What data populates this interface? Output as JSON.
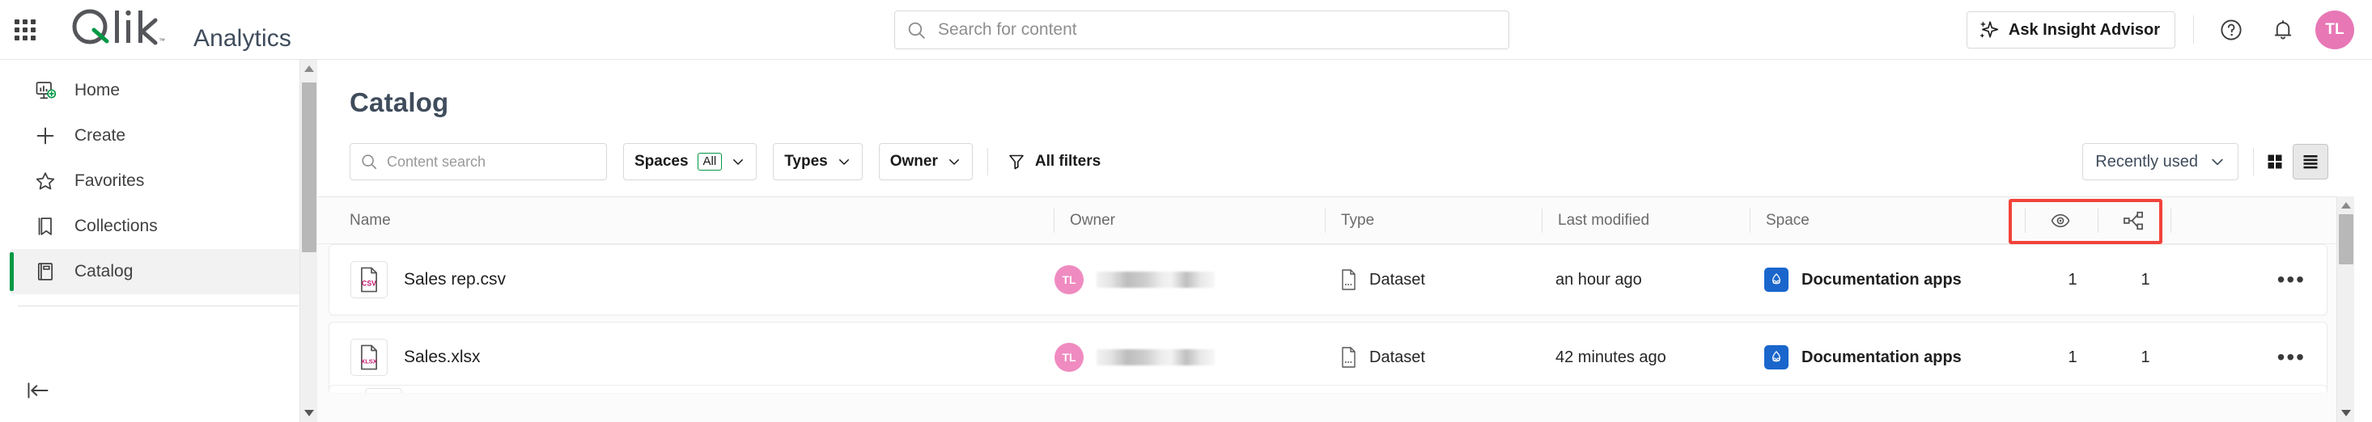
{
  "topbar": {
    "launcher_icon": "grid-apps-icon",
    "logo_text": "Qlik",
    "app_name": "Analytics",
    "search": {
      "placeholder": "Search for content",
      "value": "",
      "icon": "search-icon"
    },
    "insight_advisor_label": "Ask Insight Advisor",
    "insight_icon": "sparkle-icon",
    "help_icon": "help-circle-icon",
    "notifications_icon": "bell-icon",
    "avatar_initials": "TL",
    "avatar_color": "#e877b6"
  },
  "sidebar": {
    "items": [
      {
        "label": "Home",
        "icon": "home-chart-icon",
        "active": false
      },
      {
        "label": "Create",
        "icon": "plus-icon",
        "active": false
      },
      {
        "label": "Favorites",
        "icon": "star-icon",
        "active": false
      },
      {
        "label": "Collections",
        "icon": "bookmark-icon",
        "active": false
      },
      {
        "label": "Catalog",
        "icon": "catalog-book-icon",
        "active": true
      }
    ],
    "collapse_icon": "collapse-left-icon",
    "active_accent": "#009845"
  },
  "main": {
    "page_title": "Catalog",
    "toolbar": {
      "content_search": {
        "placeholder": "Content search",
        "value": "",
        "icon": "search-icon"
      },
      "spaces": {
        "label": "Spaces",
        "badge": "All",
        "chevron": "chevron-down-icon",
        "badge_border": "#009845"
      },
      "types": {
        "label": "Types",
        "chevron": "chevron-down-icon"
      },
      "owner": {
        "label": "Owner",
        "chevron": "chevron-down-icon"
      },
      "all_filters": {
        "label": "All filters",
        "icon": "funnel-icon"
      },
      "sort": {
        "label": "Recently used",
        "chevron": "chevron-down-icon"
      },
      "view_grid": {
        "icon": "grid-view-icon",
        "selected": false
      },
      "view_list": {
        "icon": "list-view-icon",
        "selected": true
      }
    },
    "table": {
      "columns": [
        {
          "key": "name",
          "label": "Name"
        },
        {
          "key": "owner",
          "label": "Owner"
        },
        {
          "key": "type",
          "label": "Type"
        },
        {
          "key": "last_modified",
          "label": "Last modified"
        },
        {
          "key": "space",
          "label": "Space"
        },
        {
          "key": "views",
          "label": "",
          "icon": "eye-icon"
        },
        {
          "key": "lineage",
          "label": "",
          "icon": "lineage-graph-icon"
        }
      ],
      "rows": [
        {
          "name": "Sales rep.csv",
          "file_icon": "csv-file-icon",
          "file_ext": "CSV",
          "owner_initials": "TL",
          "owner_name": "",
          "type": "Dataset",
          "type_icon": "dataset-file-icon",
          "last_modified": "an hour ago",
          "space": "Documentation apps",
          "space_icon": "shared-space-icon",
          "views": "1",
          "lineage": "1",
          "menu_icon": "more-horizontal-icon"
        },
        {
          "name": "Sales.xlsx",
          "file_icon": "xlsx-file-icon",
          "file_ext": "XLSX",
          "owner_initials": "TL",
          "owner_name": "",
          "type": "Dataset",
          "type_icon": "dataset-file-icon",
          "last_modified": "42 minutes ago",
          "space": "Documentation apps",
          "space_icon": "shared-space-icon",
          "views": "1",
          "lineage": "1",
          "menu_icon": "more-horizontal-icon"
        }
      ]
    },
    "annotation": {
      "color": "#f2433b",
      "target": "views-and-lineage-columns"
    }
  }
}
